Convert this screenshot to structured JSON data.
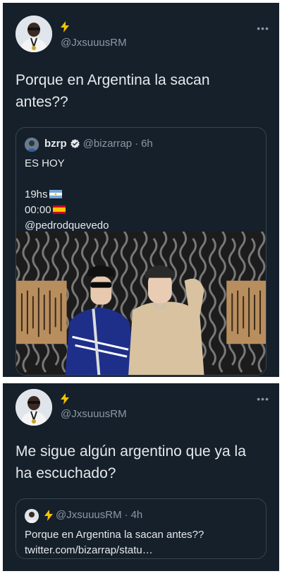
{
  "tweet1": {
    "author_emoji": "⚡",
    "handle": "@JxsuuusRM",
    "more_label": "•••",
    "text": "Porque en Argentina la sacan antes??",
    "quote": {
      "name": "bzrp",
      "handle": "@bizarrap",
      "separator": "·",
      "time": "6h",
      "lines": [
        "ES HOY",
        "",
        "19hs",
        "00:00",
        "@pedrodquevedo"
      ],
      "image_alt": "photo"
    }
  },
  "tweet2": {
    "author_emoji": "⚡",
    "handle": "@JxsuuusRM",
    "more_label": "•••",
    "text": "Me sigue algún argentino que ya la ha escuchado?",
    "quote": {
      "author_emoji": "⚡",
      "handle": "@JxsuuusRM",
      "separator": "·",
      "time": "4h",
      "lines": [
        "Porque en Argentina la sacan antes??",
        "twitter.com/bizarrap/statu…"
      ]
    }
  },
  "colors": {
    "background": "#15202b",
    "text": "#e7e9ea",
    "secondary": "#8b98a5",
    "border": "#38444d",
    "verified": "#1d9bf0",
    "bolt": "#f5c400"
  },
  "icons": [
    "bolt-icon",
    "verified-badge-icon",
    "more-options-icon",
    "argentina-flag-icon",
    "spain-flag-icon"
  ]
}
